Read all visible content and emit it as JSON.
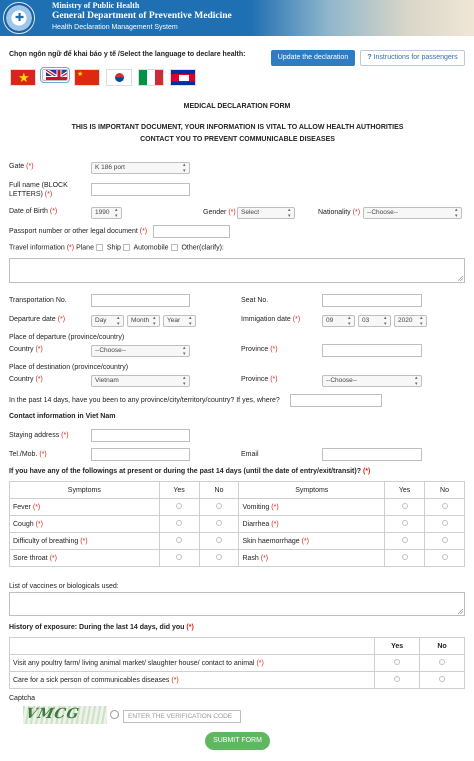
{
  "header": {
    "ministry": "Ministry of Public Health",
    "department": "General Department of Preventive Medicine",
    "system": "Health Declaration Management System"
  },
  "language_prompt": "Chọn ngôn ngữ để khai báo y tế /Select the language to declare health:",
  "buttons": {
    "update": "Update the declaration",
    "instructions": "Instructions for passengers",
    "submit": "SUBMIT FORM"
  },
  "flags": [
    "vietnam",
    "united-kingdom",
    "china",
    "korea",
    "italy",
    "cambodia"
  ],
  "form": {
    "title": "MEDICAL DECLARATION FORM",
    "notice": "THIS IS IMPORTANT DOCUMENT, YOUR INFORMATION IS VITAL TO ALLOW HEALTH AUTHORITIES CONTACT YOU TO PREVENT COMMUNICABLE DISEASES",
    "required_mark": "(*)",
    "gate_label": "Gate",
    "gate_value": "K 186 port",
    "fullname_label": "Full name (BLOCK LETTERS)",
    "dob_label": "Date of Birth",
    "dob_value": "1990",
    "gender_label": "Gender",
    "gender_value": "Select",
    "nationality_label": "Nationality",
    "nationality_value": "--Choose--",
    "passport_label": "Passport number or other legal document",
    "travel_label": "Travel information",
    "travel_options": [
      "Plane",
      "Ship",
      "Automobile",
      "Other(clarify):"
    ],
    "transport_no_label": "Transportation No.",
    "seat_label": "Seat No.",
    "departure_label": "Departure date",
    "departure": {
      "day": "Day",
      "month": "Month",
      "year": "Year"
    },
    "immigration_label": "Immigation date",
    "immigration": {
      "day": "09",
      "month": "03",
      "year": "2020"
    },
    "place_departure_label": "Place of departure (province/country)",
    "place_destination_label": "Place of destination (province/country)",
    "country_label": "Country",
    "province_label": "Province",
    "dep_country_value": "--Choose--",
    "dest_country_value": "Vietnam",
    "dest_province_value": "--Choose--",
    "past14_label": "In the past 14 days, have you been to any province/city/territory/country? If yes, where?",
    "contact_heading": "Contact information in Viet Nam",
    "staying_label": "Staying address",
    "tel_label": "Tel./Mob.",
    "email_label": "Email",
    "symptoms_question": "If you have any of the followings at present or during the past 14 days (until the date of entry/exit/transit)?",
    "symptoms_header": "Symptoms",
    "yes_label": "Yes",
    "no_label": "No",
    "symptoms_left": [
      "Fever",
      "Cough",
      "Difficulty of breathing",
      "Sore throat"
    ],
    "symptoms_right": [
      "Vomiting",
      "Diarrhea",
      "Skin haemorrhage",
      "Rash"
    ],
    "vaccines_label": "List of vaccines or biologicals used:",
    "exposure_heading": "History of exposure: During the last 14 days, did you",
    "exposure_items": [
      "Visit any poultry farm/ living animal market/ slaughter house/ contact to animal",
      "Care for a sick person of communicables diseases"
    ],
    "captcha_label": "Captcha",
    "captcha_text": "VMCG",
    "captcha_placeholder": "ENTER THE VERIFICATION CODE"
  }
}
